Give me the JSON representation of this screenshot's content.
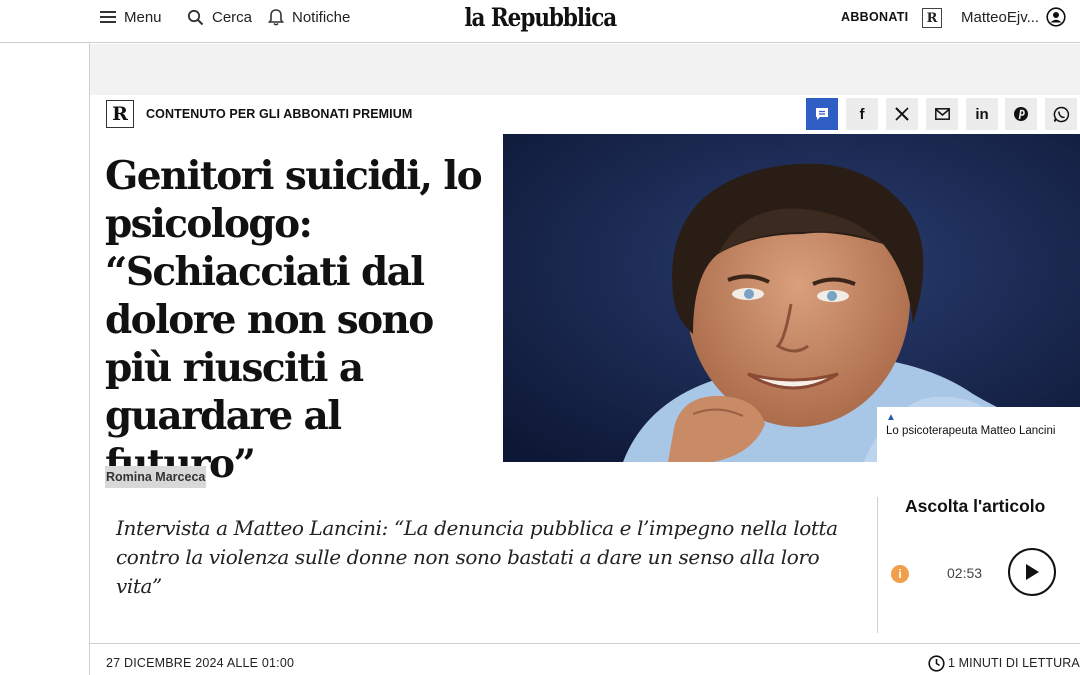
{
  "header": {
    "menu_label": "Menu",
    "search_label": "Cerca",
    "notifications_label": "Notifiche",
    "logo_text": "la Repubblica",
    "subscribe_label": "ABBONATI",
    "r_badge": "R",
    "username": "MatteoEjv..."
  },
  "premium_bar": {
    "r_logo": "R",
    "label": "CONTENUTO PER GLI ABBONATI PREMIUM"
  },
  "share": {
    "icons": [
      "comment-icon",
      "facebook-icon",
      "x-icon",
      "mail-icon",
      "linkedin-icon",
      "pinterest-icon",
      "whatsapp-icon"
    ],
    "facebook_glyph": "f",
    "x_glyph": "X",
    "linkedin_glyph": "in",
    "active_color": "#2f5ec4"
  },
  "article": {
    "title": "Genitori suicidi, lo psicologo: “Schiacciati dal dolore non sono più riusciti a guardare al futuro”",
    "author": "Romina Marceca",
    "photo_caption": "Lo psicoterapeuta Matteo Lancini",
    "caption_marker": "▲",
    "summary": "Intervista a Matteo Lancini: “La denuncia pubblica e l’impegno nella lotta contro la violenza sulle donne non sono bastati a dare un senso alla loro vita”",
    "date": "27 DICEMBRE 2024 ALLE 01:00",
    "reading_time": "1 MINUTI DI LETTURA"
  },
  "audio": {
    "title": "Ascolta l'articolo",
    "info_glyph": "i",
    "duration": "02:53",
    "info_color": "#f0a04b"
  }
}
